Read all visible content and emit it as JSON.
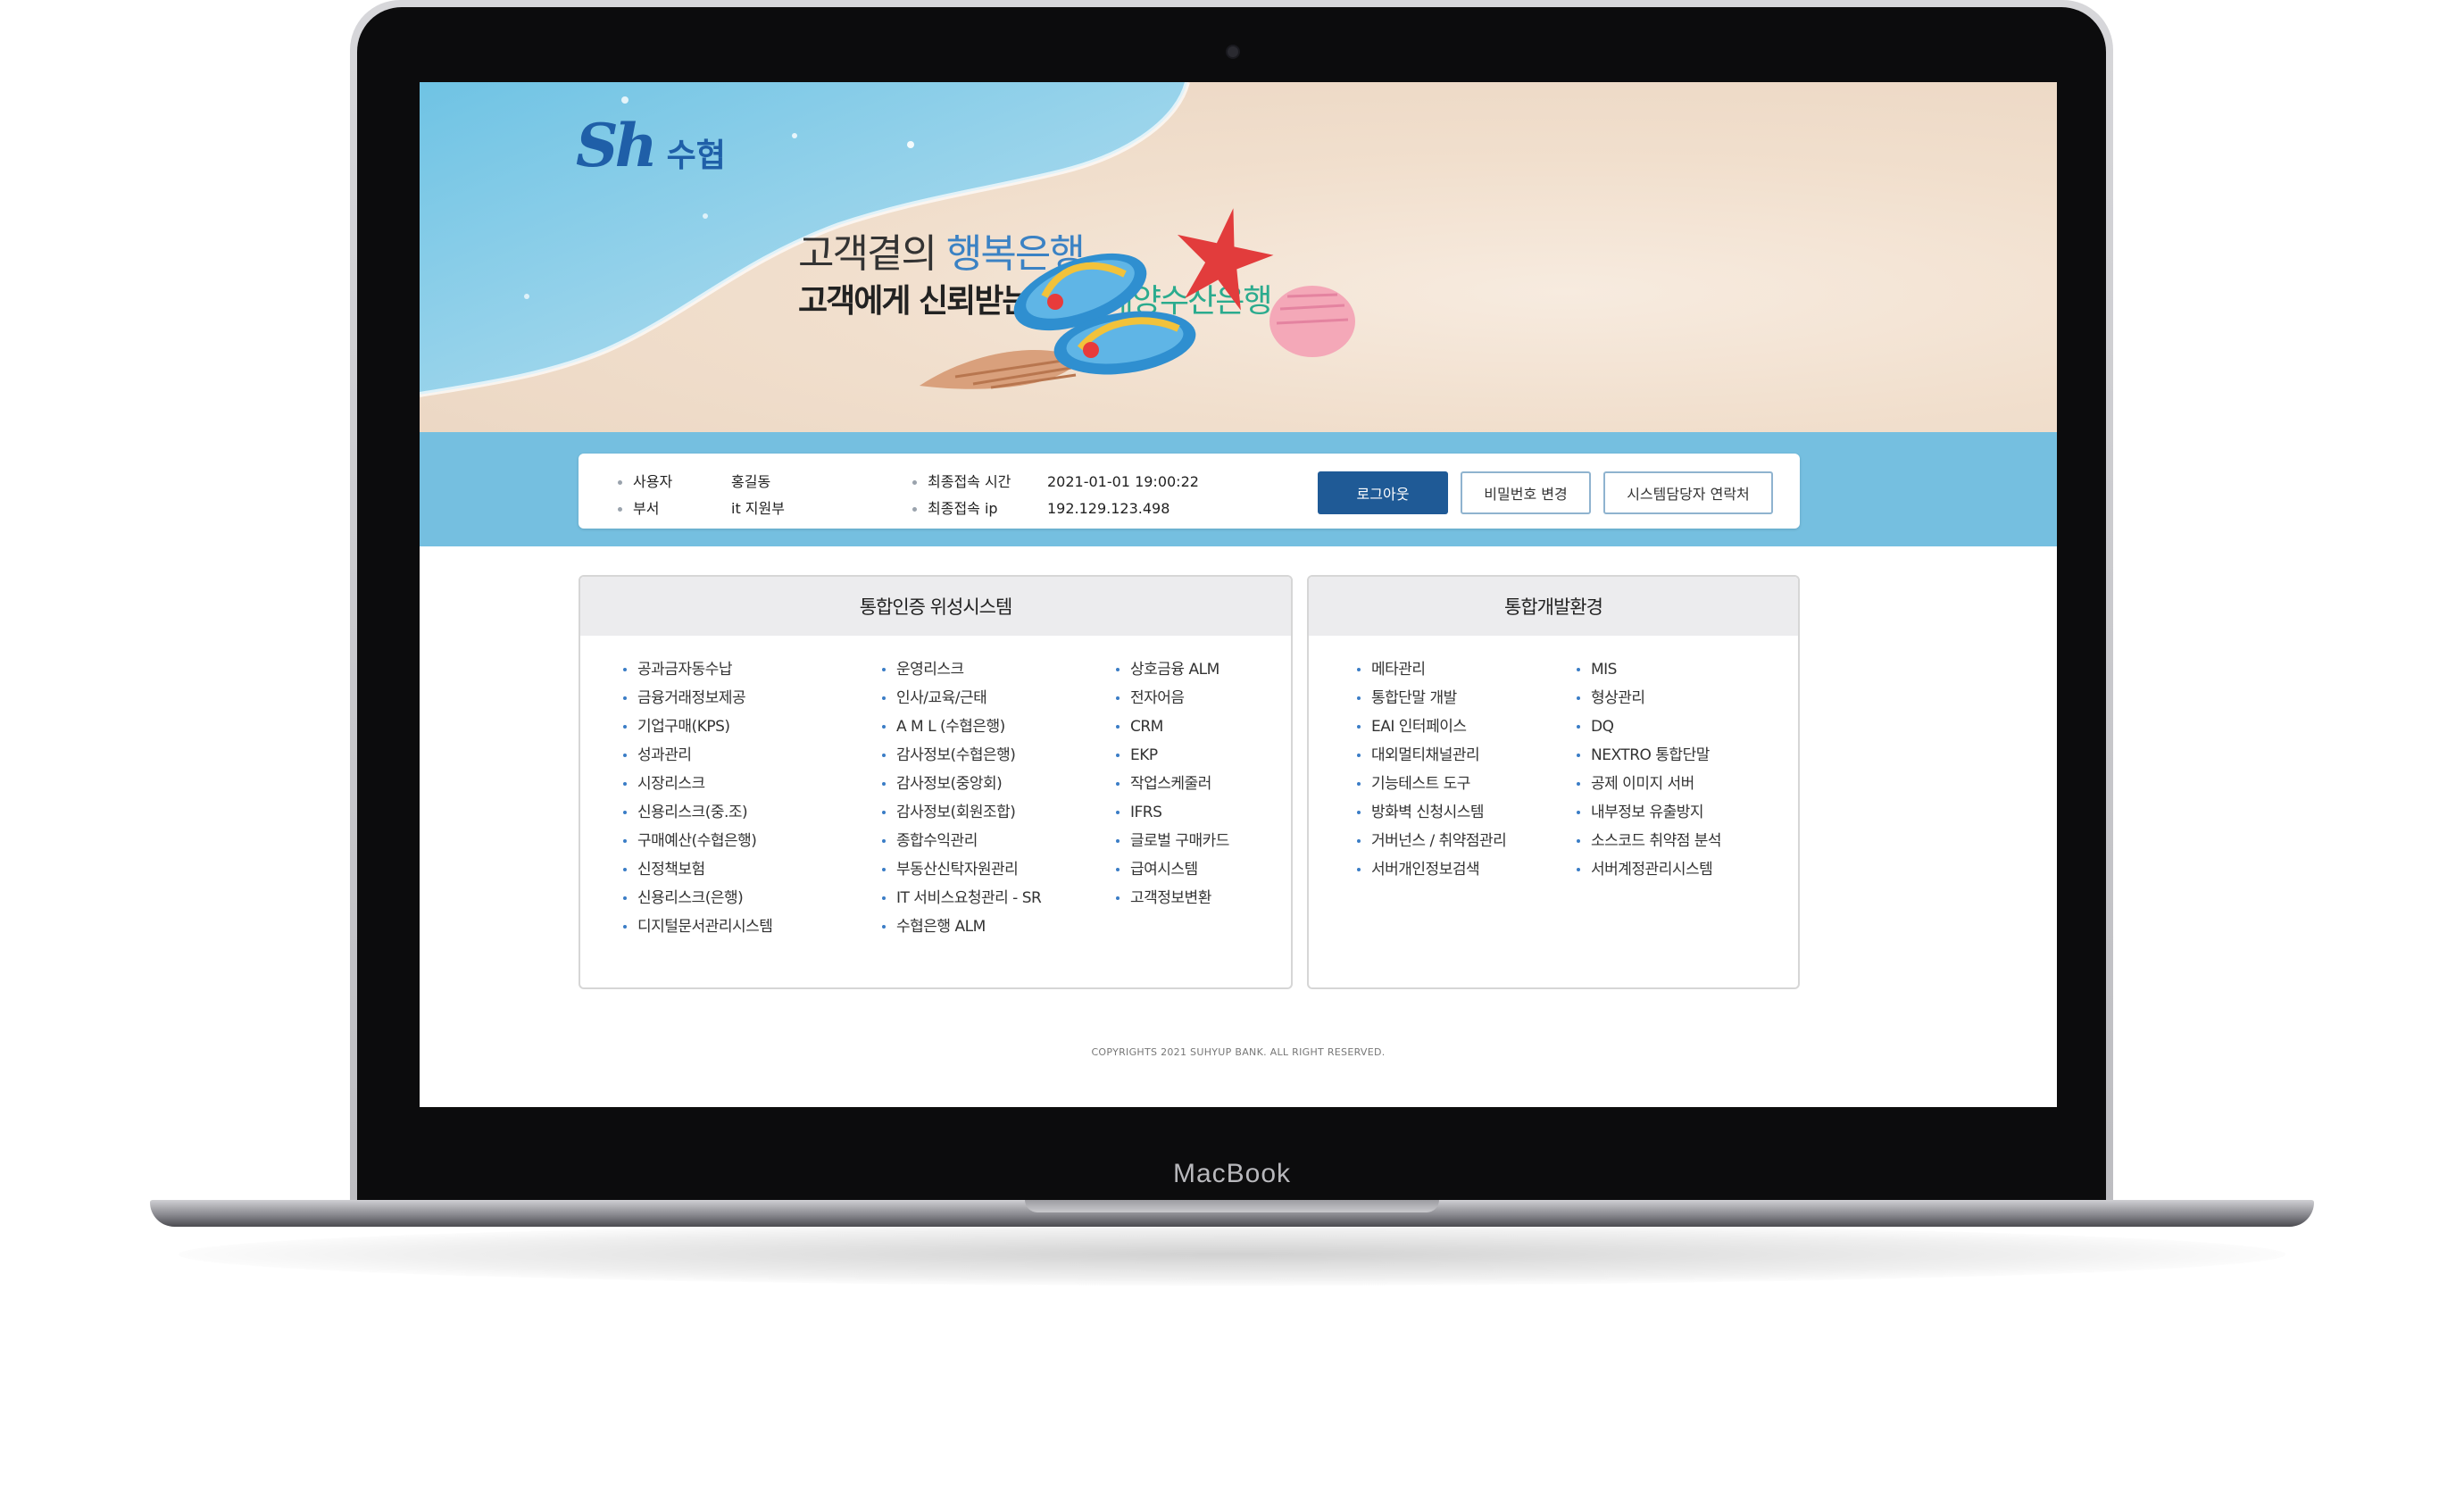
{
  "device": {
    "brand": "MacBook"
  },
  "site": {
    "logo": {
      "mark": "Sh",
      "name": "수협"
    },
    "hero": {
      "line1_prefix": "고객곁의 ",
      "line1_highlight": "행복은행",
      "line2_prefix": "고객에게 신뢰받는 일류 ",
      "line2_highlight": "해양수산은행"
    }
  },
  "user_info": {
    "user_label": "사용자",
    "user_value": "홍길동",
    "dept_label": "부서",
    "dept_value": "it 지원부",
    "last_time_label": "최종접속 시간",
    "last_time_value": "2021-01-01 19:00:22",
    "last_ip_label": "최종접속 ip",
    "last_ip_value": "192.129.123.498"
  },
  "buttons": {
    "logout": "로그아웃",
    "change_password": "비밀번호 변경",
    "contact_admin": "시스템담당자 연락처"
  },
  "panels": {
    "integrated_auth": {
      "title": "통합인증 위성시스템",
      "col1": [
        "공과금자동수납",
        "금융거래정보제공",
        "기업구매(KPS)",
        "성과관리",
        "시장리스크",
        "신용리스크(중.조)",
        "구매예산(수협은행)",
        "신정책보험",
        "신용리스크(은행)",
        "디지털문서관리시스템"
      ],
      "col2": [
        "운영리스크",
        "인사/교육/근태",
        "A M L (수협은행)",
        "감사정보(수협은행)",
        "감사정보(중앙회)",
        "감사정보(회원조합)",
        "종합수익관리",
        "부동산신탁자원관리",
        "IT 서비스요청관리 - SR",
        "수협은행 ALM"
      ],
      "col3": [
        "상호금융 ALM",
        "전자어음",
        "CRM",
        "EKP",
        "작업스케줄러",
        "IFRS",
        "글로벌 구매카드",
        "급여시스템",
        "고객정보변환"
      ]
    },
    "dev_env": {
      "title": "통합개발환경",
      "col1": [
        "메타관리",
        "통합단말 개발",
        "EAI 인터페이스",
        "대외멀티채널관리",
        "기능테스트 도구",
        "방화벽 신청시스템",
        "거버넌스 / 취약점관리",
        "서버개인정보검색"
      ],
      "col2": [
        "MIS",
        "형상관리",
        "DQ",
        "NEXTRO 통합단말",
        "공제 이미지 서버",
        "내부정보 유출방지",
        "소스코드  취약점 분석",
        "서버계정관리시스템"
      ]
    }
  },
  "footer": {
    "copyright": "COPYRIGHTS 2021 SUHYUP BANK. ALL RIGHT RESERVED."
  },
  "colors": {
    "brand_blue": "#1f5fa8",
    "info_bar": "#75bfe0",
    "logout_button": "#1f5a96",
    "hero_teal": "#2bab8e"
  }
}
